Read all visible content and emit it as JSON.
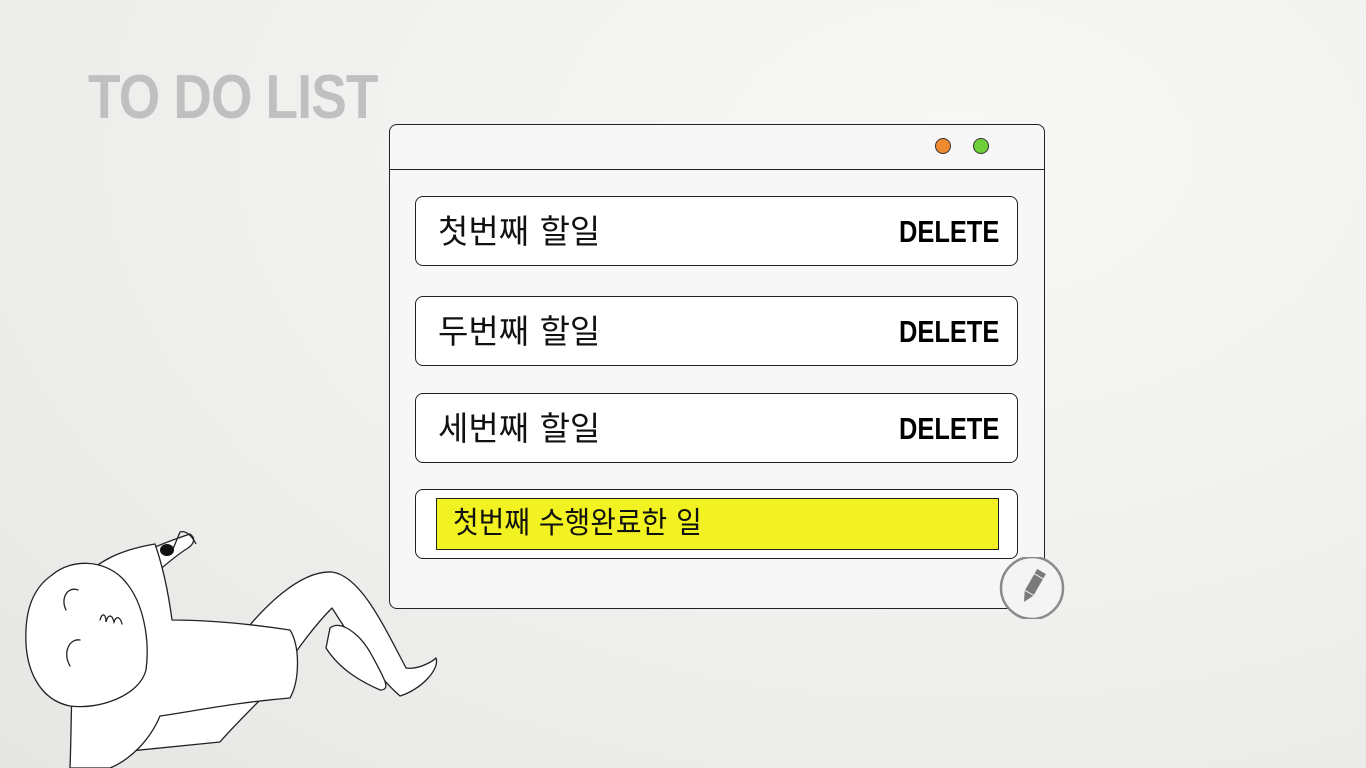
{
  "page": {
    "title": "TO DO LIST"
  },
  "window": {
    "controls": [
      {
        "name": "minimize-dot",
        "color": "#f08a30"
      },
      {
        "name": "maximize-dot",
        "color": "#6fcf3a"
      }
    ]
  },
  "todos": [
    {
      "text": "첫번째 할일",
      "delete_label": "DELETE"
    },
    {
      "text": "두번째 할일",
      "delete_label": "DELETE"
    },
    {
      "text": "세번째 할일",
      "delete_label": "DELETE"
    }
  ],
  "completed": [
    {
      "text": "첫번째 수행완료한 일",
      "highlight_color": "#f2f222"
    }
  ],
  "edit_button": {
    "icon": "pencil-icon"
  },
  "colors": {
    "title": "#c0c0c0",
    "window_bg": "#f7f7f7",
    "item_bg": "#ffffff",
    "border": "#222222"
  }
}
